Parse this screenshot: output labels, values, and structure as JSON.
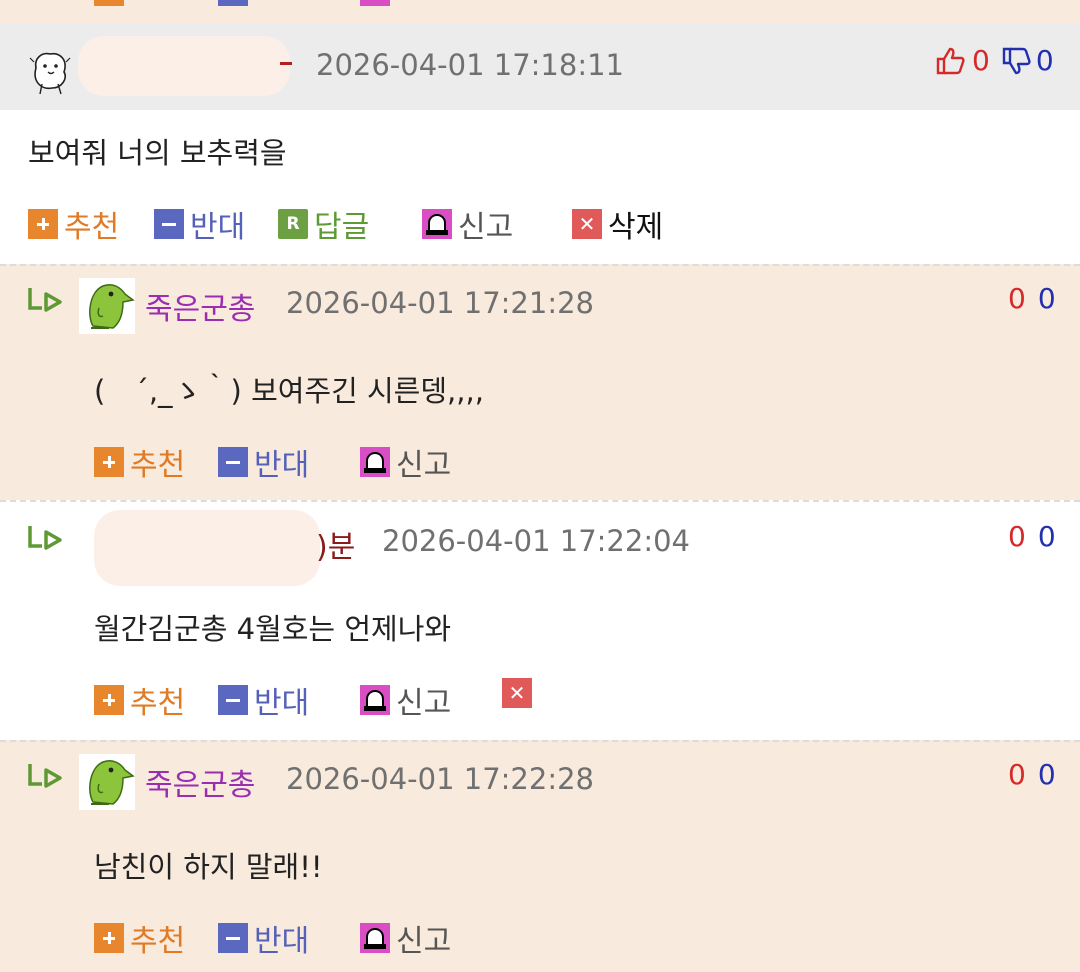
{
  "main_comment": {
    "date": "2026-04-01 17:18:11",
    "likes": "0",
    "dislikes": "0",
    "text": "보여줘 너의 보추력을",
    "actions": {
      "recommend": "추천",
      "oppose": "반대",
      "reply": "답글",
      "report": "신고",
      "delete": "삭제"
    }
  },
  "replies": [
    {
      "nickname": "죽은군총",
      "date": "2026-04-01 17:21:28",
      "up": "0",
      "down": "0",
      "text": "(　´,_ゝ｀) 보여주긴 시른뎅,,,,",
      "actions": {
        "recommend": "추천",
        "oppose": "반대",
        "report": "신고"
      }
    },
    {
      "nickname_suffix": ")분",
      "date": "2026-04-01 17:22:04",
      "up": "0",
      "down": "0",
      "text": "월간김군총 4월호는 언제나와",
      "actions": {
        "recommend": "추천",
        "oppose": "반대",
        "report": "신고"
      }
    },
    {
      "nickname": "죽은군총",
      "date": "2026-04-01 17:22:28",
      "up": "0",
      "down": "0",
      "text": "남친이 하지 말래!!",
      "actions": {
        "recommend": "추천",
        "oppose": "반대",
        "report": "신고"
      }
    }
  ],
  "colors": {
    "reply_bg": "#f8eadd",
    "header_bg": "#ececec",
    "recommend": "#e07a24",
    "oppose": "#5560b8",
    "reply": "#5e9a34",
    "report": "#d94ec4",
    "delete": "#e05a5a",
    "nickname": "#9b2db0",
    "like": "#d42a2a",
    "dislike": "#2230b0"
  },
  "icons": [
    "thumbs-up-icon",
    "thumbs-down-icon",
    "plus-icon",
    "minus-icon",
    "reply-r-icon",
    "siren-icon",
    "delete-x-icon",
    "reply-arrow-icon",
    "dino-avatar",
    "seal-avatar"
  ]
}
